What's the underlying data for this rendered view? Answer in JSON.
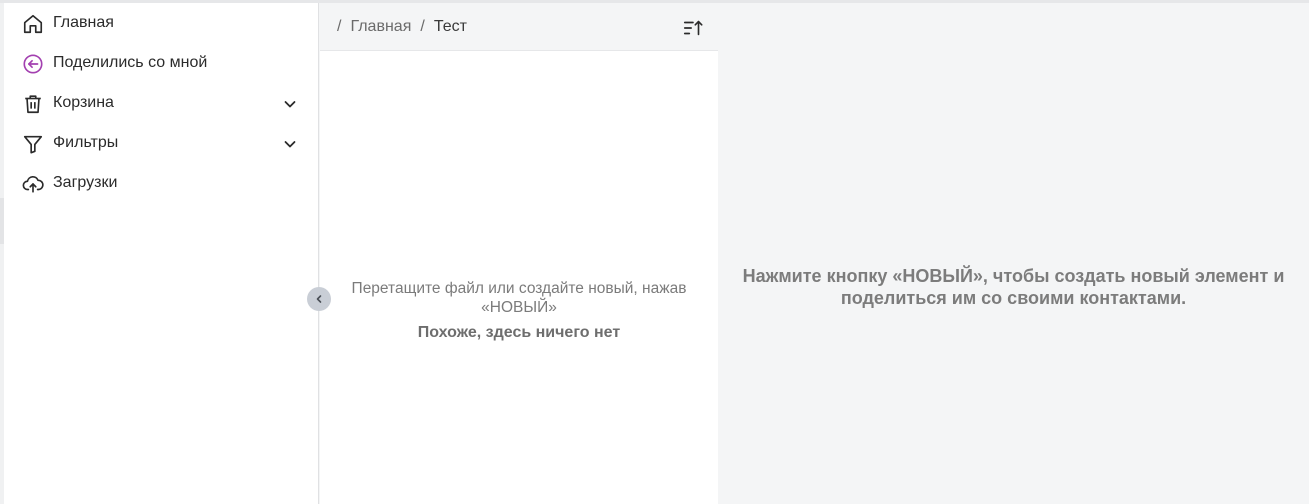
{
  "sidebar": {
    "items": [
      {
        "label": "Главная",
        "icon": "home-icon",
        "has_chevron": false
      },
      {
        "label": "Поделились со мной",
        "icon": "shared-with-me-icon",
        "has_chevron": false
      },
      {
        "label": "Корзина",
        "icon": "trash-icon",
        "has_chevron": true
      },
      {
        "label": "Фильтры",
        "icon": "filter-icon",
        "has_chevron": true
      },
      {
        "label": "Загрузки",
        "icon": "upload-icon",
        "has_chevron": false
      }
    ]
  },
  "breadcrumb": {
    "separator": "/",
    "items": [
      "Главная",
      "Тест"
    ]
  },
  "list": {
    "empty_hint": "Перетащите файл или создайте новый, нажав «НОВЫЙ»",
    "empty_title": "Похоже, здесь ничего нет"
  },
  "details": {
    "message": "Нажмите кнопку «НОВЫЙ», чтобы создать новый элемент и поделиться им со своими контактами."
  },
  "icons": {
    "sort": "sort-ascending-icon",
    "collapse": "chevron-left-icon"
  },
  "colors": {
    "accent_purple": "#a340b0",
    "text_dark": "#2b2b2b",
    "muted": "#7c7c7c",
    "panel_bg": "#f4f5f6"
  }
}
